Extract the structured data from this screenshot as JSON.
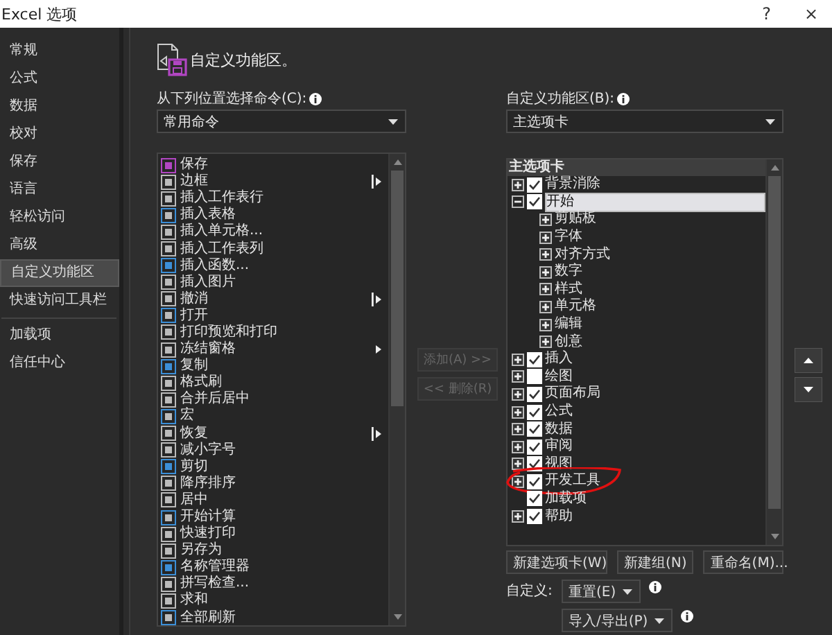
{
  "window": {
    "title": "Excel 选项",
    "help": "?",
    "close": "×"
  },
  "sidebar": {
    "items": [
      {
        "label": "常规",
        "selected": false,
        "divider_after": false
      },
      {
        "label": "公式",
        "selected": false,
        "divider_after": false
      },
      {
        "label": "数据",
        "selected": false,
        "divider_after": false
      },
      {
        "label": "校对",
        "selected": false,
        "divider_after": false
      },
      {
        "label": "保存",
        "selected": false,
        "divider_after": false
      },
      {
        "label": "语言",
        "selected": false,
        "divider_after": false
      },
      {
        "label": "轻松访问",
        "selected": false,
        "divider_after": false
      },
      {
        "label": "高级",
        "selected": false,
        "divider_after": false
      },
      {
        "label": "自定义功能区",
        "selected": true,
        "divider_after": false
      },
      {
        "label": "快速访问工具栏",
        "selected": false,
        "divider_after": true
      },
      {
        "label": "加载项",
        "selected": false,
        "divider_after": false
      },
      {
        "label": "信任中心",
        "selected": false,
        "divider_after": false
      }
    ]
  },
  "heading": "自定义功能区。",
  "commands": {
    "label": "从下列位置选择命令(C):",
    "dropdown": "常用命令",
    "items": [
      {
        "label": "保存",
        "kind": "plain"
      },
      {
        "label": "边框",
        "kind": "split"
      },
      {
        "label": "插入工作表行",
        "kind": "plain"
      },
      {
        "label": "插入表格",
        "kind": "plain"
      },
      {
        "label": "插入单元格...",
        "kind": "plain"
      },
      {
        "label": "插入工作表列",
        "kind": "plain"
      },
      {
        "label": "插入函数...",
        "kind": "plain"
      },
      {
        "label": "插入图片",
        "kind": "plain"
      },
      {
        "label": "撤消",
        "kind": "split"
      },
      {
        "label": "打开",
        "kind": "plain"
      },
      {
        "label": "打印预览和打印",
        "kind": "plain"
      },
      {
        "label": "冻结窗格",
        "kind": "menu"
      },
      {
        "label": "复制",
        "kind": "plain"
      },
      {
        "label": "格式刷",
        "kind": "plain"
      },
      {
        "label": "合并后居中",
        "kind": "plain"
      },
      {
        "label": "宏",
        "kind": "plain"
      },
      {
        "label": "恢复",
        "kind": "split"
      },
      {
        "label": "减小字号",
        "kind": "plain"
      },
      {
        "label": "剪切",
        "kind": "plain"
      },
      {
        "label": "降序排序",
        "kind": "plain"
      },
      {
        "label": "居中",
        "kind": "plain"
      },
      {
        "label": "开始计算",
        "kind": "plain"
      },
      {
        "label": "快速打印",
        "kind": "plain"
      },
      {
        "label": "另存为",
        "kind": "plain"
      },
      {
        "label": "名称管理器",
        "kind": "plain"
      },
      {
        "label": "拼写检查...",
        "kind": "plain"
      },
      {
        "label": "求和",
        "kind": "plain"
      },
      {
        "label": "全部刷新",
        "kind": "plain"
      }
    ]
  },
  "transfer_buttons": [
    {
      "label": "添加(A) >>",
      "disabled": true
    },
    {
      "label": "<< 删除(R)",
      "disabled": true
    }
  ],
  "ribbon": {
    "label": "自定义功能区(B):",
    "dropdown": "主选项卡",
    "tree_header": "主选项卡",
    "tabs": [
      {
        "label": "背景消除",
        "kind": "tab",
        "checked": true,
        "expanded": false,
        "selected": false
      },
      {
        "label": "开始",
        "kind": "tab",
        "checked": true,
        "expanded": true,
        "selected": true,
        "children": [
          {
            "label": "剪贴板",
            "kind": "group",
            "expanded": false
          },
          {
            "label": "字体",
            "kind": "group",
            "expanded": false
          },
          {
            "label": "对齐方式",
            "kind": "group",
            "expanded": false
          },
          {
            "label": "数字",
            "kind": "group",
            "expanded": false
          },
          {
            "label": "样式",
            "kind": "group",
            "expanded": false
          },
          {
            "label": "单元格",
            "kind": "group",
            "expanded": false
          },
          {
            "label": "编辑",
            "kind": "group",
            "expanded": false
          },
          {
            "label": "创意",
            "kind": "group",
            "expanded": false
          }
        ]
      },
      {
        "label": "插入",
        "kind": "tab",
        "checked": true,
        "expanded": false,
        "selected": false
      },
      {
        "label": "绘图",
        "kind": "tab",
        "checked": false,
        "expanded": false,
        "selected": false
      },
      {
        "label": "页面布局",
        "kind": "tab",
        "checked": true,
        "expanded": false,
        "selected": false
      },
      {
        "label": "公式",
        "kind": "tab",
        "checked": true,
        "expanded": false,
        "selected": false
      },
      {
        "label": "数据",
        "kind": "tab",
        "checked": true,
        "expanded": false,
        "selected": false
      },
      {
        "label": "审阅",
        "kind": "tab",
        "checked": true,
        "expanded": false,
        "selected": false
      },
      {
        "label": "视图",
        "kind": "tab",
        "checked": true,
        "expanded": false,
        "selected": false
      },
      {
        "label": "开发工具",
        "kind": "tab",
        "checked": true,
        "expanded": false,
        "selected": false,
        "circled": true
      },
      {
        "label": "加载项",
        "kind": "leaf",
        "checked": true,
        "selected": false
      },
      {
        "label": "帮助",
        "kind": "tab",
        "checked": true,
        "expanded": false,
        "selected": false
      }
    ],
    "buttons": [
      "新建选项卡(W)",
      "新建组(N)",
      "重命名(M)..."
    ],
    "customize_label": "自定义:",
    "reset": "重置(E)",
    "import_export": "导入/导出(P)"
  }
}
